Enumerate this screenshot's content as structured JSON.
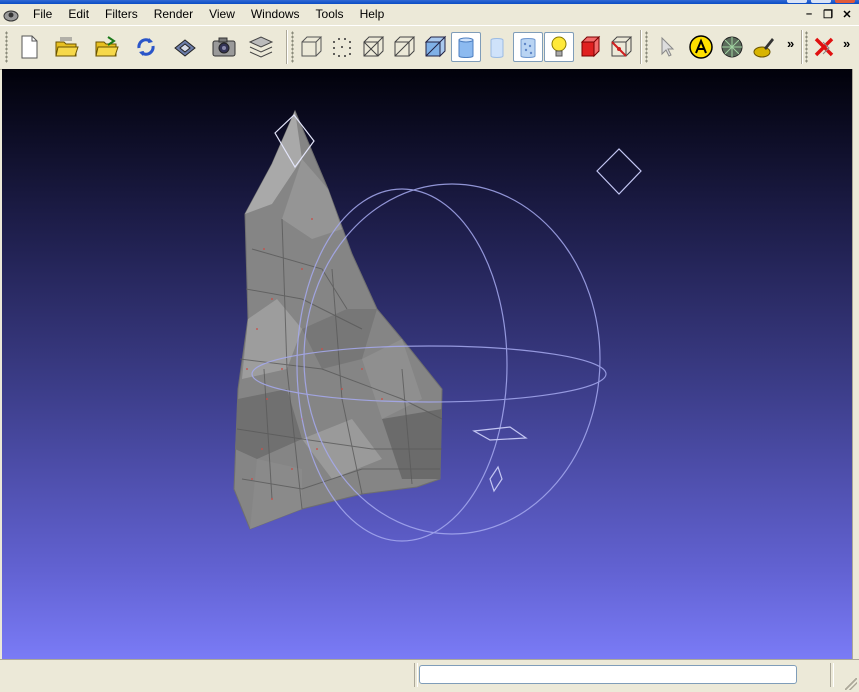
{
  "menu": {
    "items": [
      "File",
      "Edit",
      "Filters",
      "Render",
      "View",
      "Windows",
      "Tools",
      "Help"
    ],
    "controls": {
      "minimize": "–",
      "restore": "❐",
      "close": "✕"
    }
  },
  "toolbar": {
    "overflow_chevron": "»",
    "buttons": [
      {
        "name": "new-project-icon"
      },
      {
        "name": "open-project-icon"
      },
      {
        "name": "import-mesh-icon"
      },
      {
        "name": "reload-icon"
      },
      {
        "name": "save-icon"
      },
      {
        "name": "snapshot-icon"
      },
      {
        "name": "layers-icon"
      },
      {
        "name": "bounding-box-icon"
      },
      {
        "name": "points-icon"
      },
      {
        "name": "wireframe-icon"
      },
      {
        "name": "hidden-lines-icon"
      },
      {
        "name": "flat-lines-icon"
      },
      {
        "name": "flat-shading-icon"
      },
      {
        "name": "smooth-shading-icon"
      },
      {
        "name": "texture-icon"
      },
      {
        "name": "light-bulb-icon"
      },
      {
        "name": "back-face-icon"
      },
      {
        "name": "selected-faces-icon"
      },
      {
        "name": "pointer-icon"
      },
      {
        "name": "annotation-a-icon"
      },
      {
        "name": "measure-tool-icon"
      },
      {
        "name": "paint-tool-icon"
      },
      {
        "name": "delete-selection-icon"
      }
    ]
  },
  "status": {
    "field_text": ""
  },
  "colors": {
    "viewport_top": "#01010a",
    "viewport_bottom": "#7a7bf6",
    "trackball": "#a6aaf0",
    "mesh": "#8a8a8a"
  }
}
